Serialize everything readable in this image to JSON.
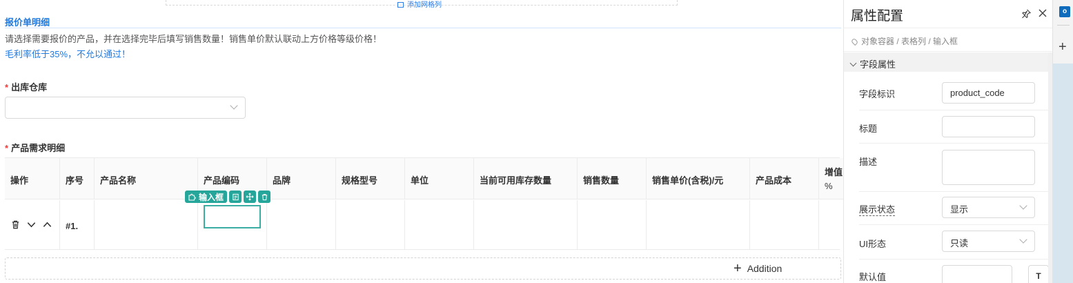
{
  "canvas": {
    "grid_add_label": "添加网格列",
    "section_title": "报价单明细",
    "notes": [
      "请选择需要报价的产品，并在选择完毕后填写销售数量！销售单价默认联动上方价格等级价格！",
      "毛利率低于35%，不允以通过！"
    ],
    "warehouse": {
      "required_mark": "*",
      "label": "出库仓库",
      "value": ""
    },
    "product_detail": {
      "required_mark": "*",
      "label": "产品需求明细"
    },
    "table": {
      "headers": [
        "操作",
        "序号",
        "产品名称",
        "产品编码",
        "品牌",
        "规格型号",
        "单位",
        "当前可用库存数量",
        "销售数量",
        "销售单价(含税)/元",
        "产品成本",
        "增值",
        "%"
      ],
      "rows": [
        {
          "index": "#1."
        }
      ]
    },
    "selected_field": {
      "tag": "输入框"
    },
    "add_row_label": "Addition"
  },
  "panel": {
    "title": "属性配置",
    "breadcrumb": "对象容器 / 表格列 / 输入框",
    "group": "字段属性",
    "fields": {
      "field_id": {
        "label": "字段标识",
        "value": "product_code"
      },
      "title": {
        "label": "标题",
        "value": ""
      },
      "description": {
        "label": "描述",
        "value": ""
      },
      "display_state": {
        "label": "展示状态",
        "value": "显示"
      },
      "ui_mode": {
        "label": "UI形态",
        "value": "只读"
      },
      "default_value": {
        "label": "默认值",
        "value": "",
        "button": "T"
      }
    }
  },
  "side": {
    "outlook_letter": "o"
  },
  "colors": {
    "accent": "#1f7ae0",
    "teal": "#26a69a",
    "arrow": "#e8392d",
    "required": "#f03c3c"
  },
  "icons": [
    "grid-column-icon",
    "pin-icon",
    "close-icon",
    "location-icon",
    "chevron-down-icon",
    "trash-icon",
    "move-down-icon",
    "move-up-icon",
    "puzzle-icon",
    "copy-icon",
    "drag-move-icon",
    "delete-icon",
    "plus-icon",
    "text-format-icon",
    "outlook-icon"
  ]
}
